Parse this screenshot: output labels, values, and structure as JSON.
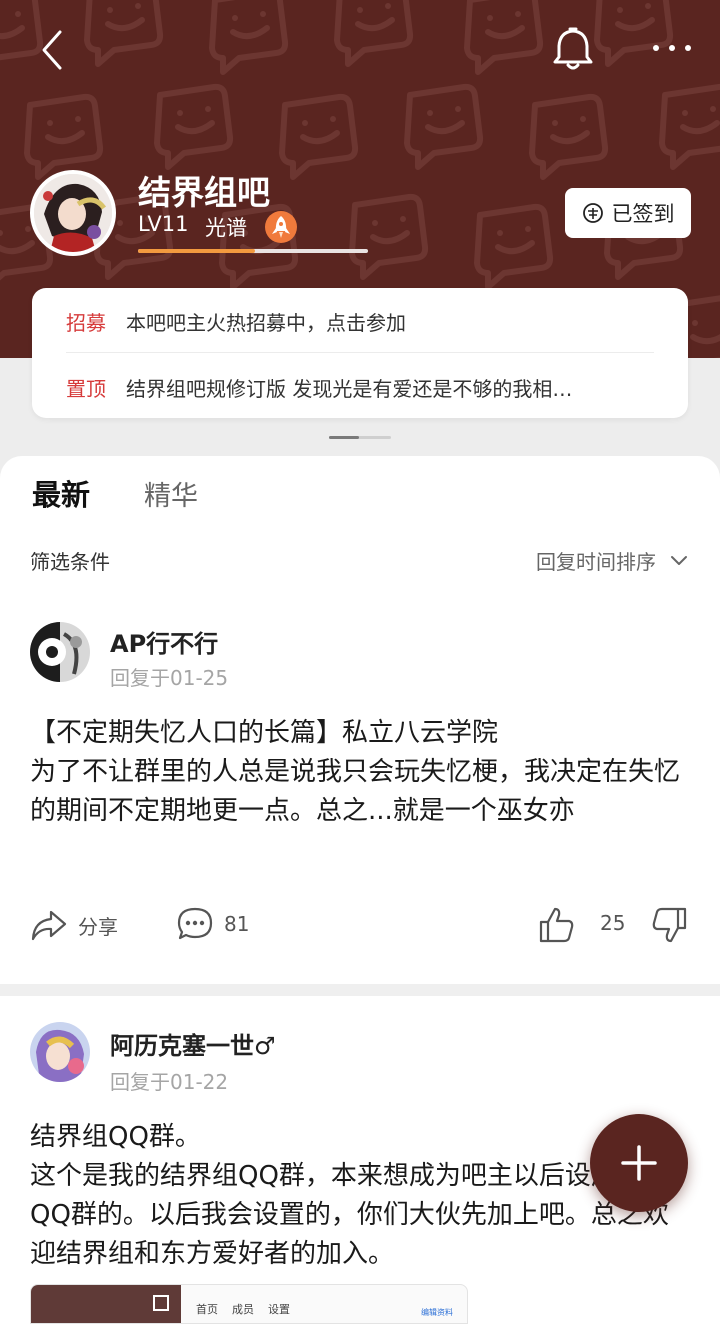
{
  "colors": {
    "hero_bg": "#5a2520",
    "accent_orange": "#f39a3f",
    "tag_red": "#d63b3b",
    "fab_bg": "#5a2520"
  },
  "header": {
    "icons": [
      "back-arrow-icon",
      "bell-icon",
      "more-icon"
    ]
  },
  "forum": {
    "name": "结界组吧",
    "level": "LV11",
    "level_name": "光谱",
    "level_progress": 0.51,
    "sign_label": "已签到"
  },
  "notices": [
    {
      "tag": "招募",
      "text": "本吧吧主火热招募中，点击参加"
    },
    {
      "tag": "置顶",
      "text": "结界组吧规修订版 发现光是有爱还是不够的我相…"
    }
  ],
  "tabs": [
    {
      "label": "最新",
      "active": true
    },
    {
      "label": "精华",
      "active": false
    }
  ],
  "filter": {
    "label": "筛选条件",
    "sort": "回复时间排序"
  },
  "posts": [
    {
      "author": "AP行不行",
      "time": "回复于01-25",
      "body": "【不定期失忆人口的长篇】私立八云学院\n为了不让群里的人总是说我只会玩失忆梗，我决定在失忆的期间不定期地更一点。总之...就是一个巫女亦",
      "share_label": "分享",
      "comments": "81",
      "likes": "25"
    },
    {
      "author": "阿历克塞一世♂",
      "time": "回复于01-22",
      "body": "结界组QQ群。\n这个是我的结界组QQ群，本来想成为吧主以后设成官方QQ群的。以后我会设置的，你们大伙先加上吧。总之欢迎结界组和东方爱好者的加入。"
    }
  ],
  "preview": {
    "nav": [
      "首页",
      "成员",
      "设置"
    ],
    "link": "编辑资料"
  }
}
